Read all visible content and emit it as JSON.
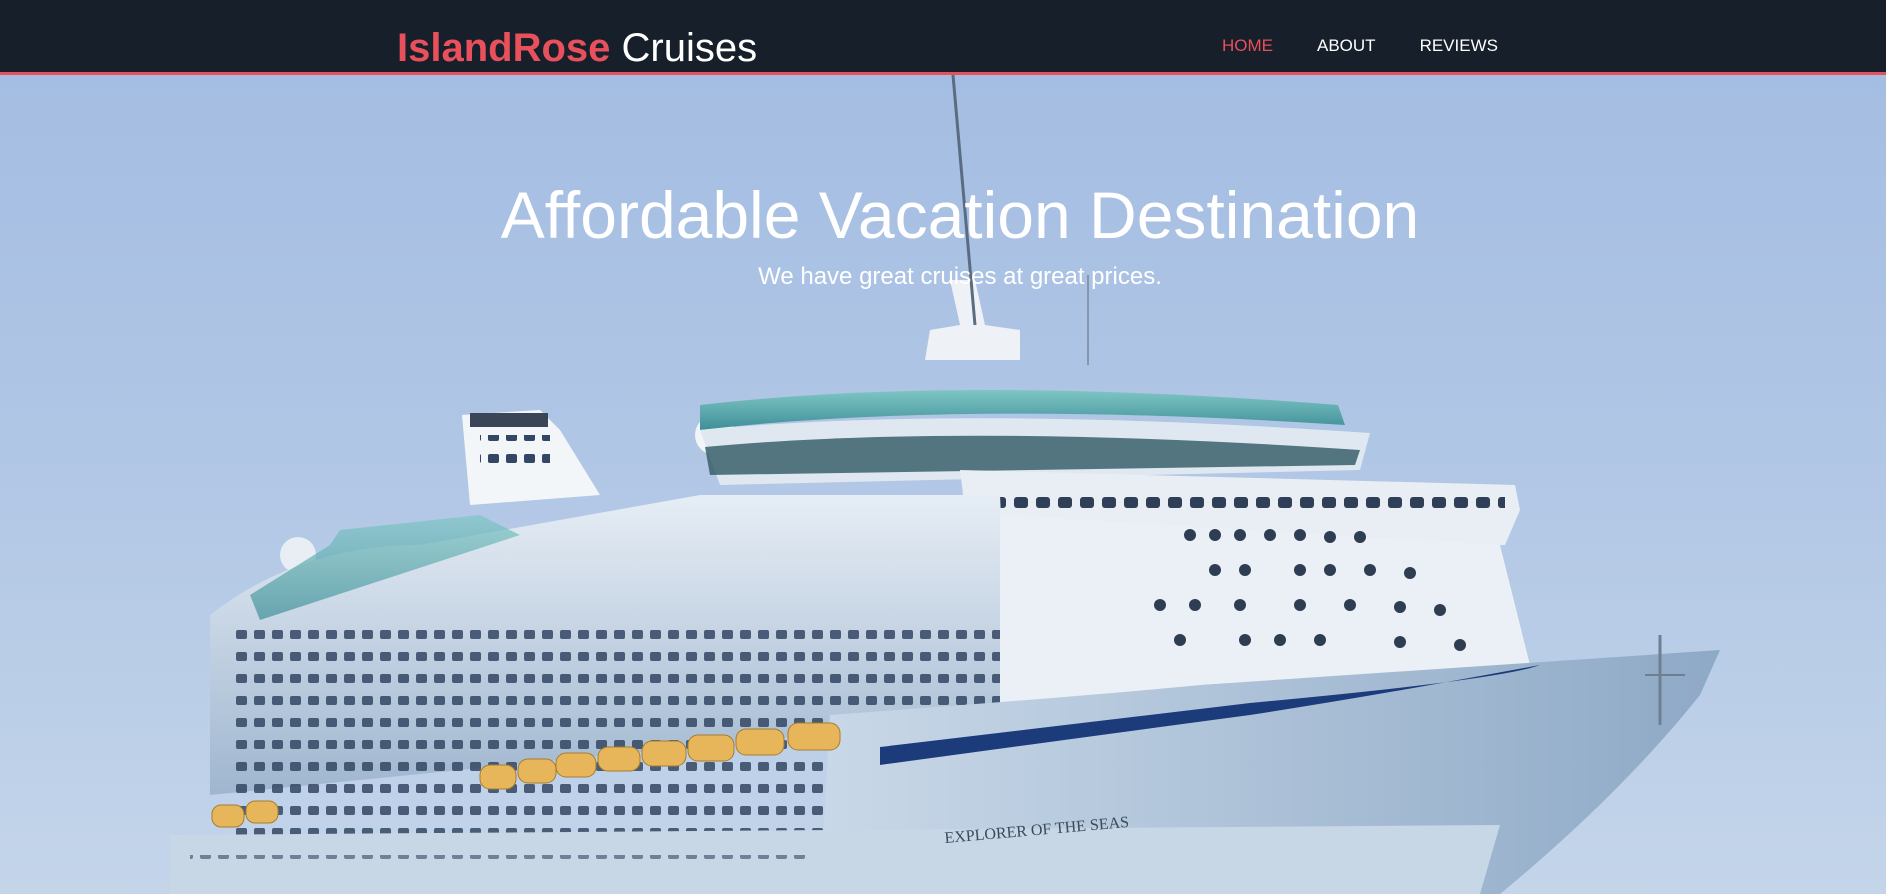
{
  "brand": {
    "part1": "IslandRose",
    "part2": "Cruises"
  },
  "nav": {
    "items": [
      {
        "label": "HOME",
        "active": true
      },
      {
        "label": "ABOUT",
        "active": false
      },
      {
        "label": "REVIEWS",
        "active": false
      }
    ]
  },
  "hero": {
    "title": "Affordable Vacation Destination",
    "subtitle": "We have great cruises at great prices.",
    "ship_name": "EXPLORER OF THE SEAS"
  },
  "colors": {
    "nav_bg": "#161f2a",
    "accent": "#e8505b",
    "text_light": "#ffffff"
  }
}
